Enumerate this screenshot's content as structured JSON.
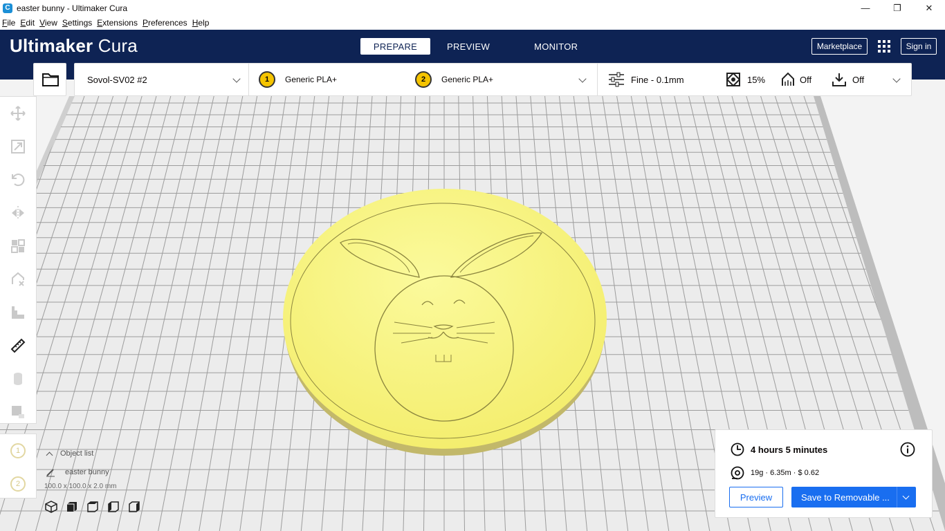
{
  "window": {
    "title": "easter bunny - Ultimaker Cura",
    "app_icon": "C",
    "minimize": "—",
    "restore": "❐",
    "close": "✕"
  },
  "menu": [
    "File",
    "Edit",
    "View",
    "Settings",
    "Extensions",
    "Preferences",
    "Help"
  ],
  "header": {
    "logo_bold": "Ultimaker",
    "logo_light": "Cura",
    "tabs": [
      "PREPARE",
      "PREVIEW",
      "MONITOR"
    ],
    "marketplace": "Marketplace",
    "sign_in": "Sign in",
    "color": "#0e2354"
  },
  "printer": {
    "name": "Sovol-SV02 #2"
  },
  "extruders": [
    {
      "number": "1",
      "material": "Generic PLA+"
    },
    {
      "number": "2",
      "material": "Generic PLA+"
    }
  ],
  "print_settings": {
    "profile": "Fine - 0.1mm",
    "infill": "15%",
    "support": "Off",
    "adhesion": "Off"
  },
  "object_list": {
    "header": "Object list",
    "item": "easter bunny",
    "dimensions": "100.0 x 100.0 x 2.0 mm"
  },
  "estimate": {
    "time": "4 hours 5 minutes",
    "material": "19g · 6.35m · $ 0.62",
    "preview_button": "Preview",
    "save_button": "Save to Removable ..."
  },
  "colors": {
    "accent": "#196ef0",
    "model": "#f5f07a",
    "build_plate": "#ececec"
  },
  "icons": [
    "move-icon",
    "scale-icon",
    "rotate-icon",
    "mirror-icon",
    "per-model-settings-icon",
    "support-blocker-icon",
    "layer-icon",
    "measure-icon",
    "cylinder-icon",
    "custom-support-icon"
  ]
}
